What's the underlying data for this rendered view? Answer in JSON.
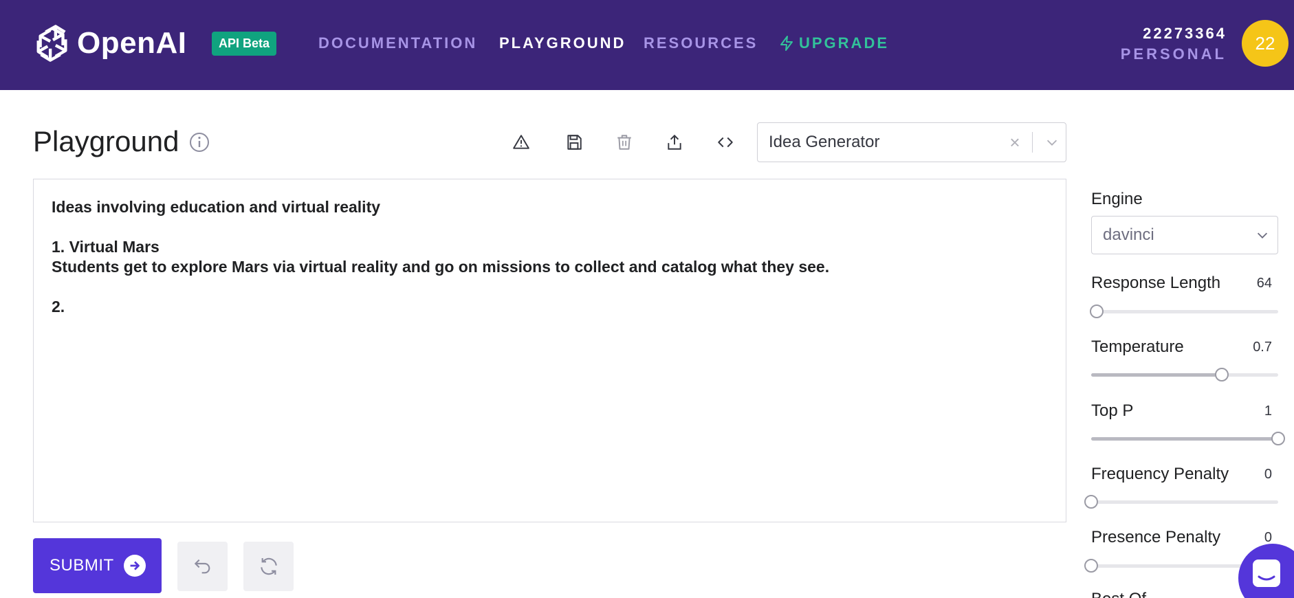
{
  "header": {
    "logo_text": "OpenAI",
    "badge": "API Beta",
    "nav": [
      {
        "label": "DOCUMENTATION",
        "active": false
      },
      {
        "label": "PLAYGROUND",
        "active": true
      },
      {
        "label": "RESOURCES",
        "active": false
      },
      {
        "label": "UPGRADE",
        "active": false
      }
    ],
    "account_id": "22273364",
    "account_type": "PERSONAL",
    "avatar_text": "22"
  },
  "page": {
    "title": "Playground",
    "toolbar_icons": [
      "warning-icon",
      "save-icon",
      "trash-icon",
      "share-icon",
      "code-icon"
    ],
    "preset": {
      "value": "Idea Generator",
      "clear": "×"
    }
  },
  "editor": {
    "lines": [
      "Ideas involving education and virtual reality",
      "",
      "1. Virtual Mars",
      "Students get to explore Mars via virtual reality and go on missions to collect and catalog what they see.",
      "",
      "2."
    ]
  },
  "actions": {
    "submit_label": "SUBMIT",
    "undo_icon": "undo-icon",
    "regenerate_icon": "regenerate-icon"
  },
  "settings": {
    "engine_label": "Engine",
    "engine_value": "davinci",
    "params": [
      {
        "label": "Response Length",
        "value": "64",
        "fraction": 0.03
      },
      {
        "label": "Temperature",
        "value": "0.7",
        "fraction": 0.7
      },
      {
        "label": "Top P",
        "value": "1",
        "fraction": 1.0
      },
      {
        "label": "Frequency Penalty",
        "value": "0",
        "fraction": 0.0
      },
      {
        "label": "Presence Penalty",
        "value": "0",
        "fraction": 0.0
      }
    ],
    "next_label": "Best Of"
  },
  "colors": {
    "header_bg": "#3c2579",
    "accent": "#5436da",
    "badge": "#10a37f",
    "upgrade": "#32c29a",
    "avatar": "#f5c518"
  }
}
